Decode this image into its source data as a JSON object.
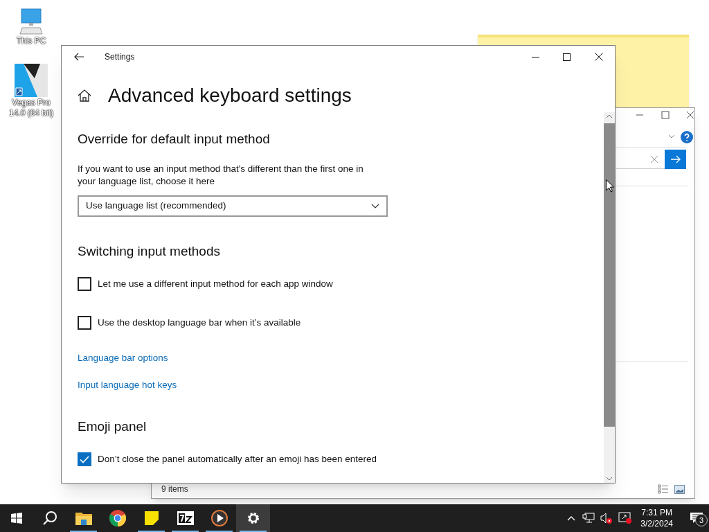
{
  "desktop_icons": [
    {
      "kind": "computer",
      "label": "This PC"
    },
    {
      "kind": "vegas",
      "label": "Vegas Pro 14.0 (64 bit)"
    }
  ],
  "background_window": {
    "status": "9 items"
  },
  "settings": {
    "title": "Settings",
    "heading": "Advanced keyboard settings",
    "sections": [
      {
        "title": "Override for default input method",
        "items": [
          {
            "kind": "text",
            "text": "If you want to use an input method that's different than the first one in your language list, choose it here"
          },
          {
            "kind": "dropdown",
            "value": "Use language list (recommended)"
          }
        ]
      },
      {
        "title": "Switching input methods",
        "items": [
          {
            "kind": "checkbox",
            "label": "Let me use a different input method for each app window",
            "checked": false
          },
          {
            "kind": "checkbox",
            "label": "Use the desktop language bar when it’s available",
            "checked": false
          },
          {
            "kind": "link",
            "label": "Language bar options"
          },
          {
            "kind": "link",
            "label": "Input language hot keys"
          }
        ]
      },
      {
        "title": "Emoji panel",
        "items": [
          {
            "kind": "checkbox",
            "label": "Don’t close the panel automatically after an emoji has been entered",
            "checked": true
          }
        ]
      }
    ]
  },
  "taskbar": {
    "apps": [
      {
        "kind": "explorer",
        "running": true,
        "selected": false
      },
      {
        "kind": "chrome",
        "running": false,
        "selected": false
      },
      {
        "kind": "notes",
        "running": true,
        "selected": false
      },
      {
        "kind": "zip",
        "running": true,
        "selected": false
      },
      {
        "kind": "player",
        "running": true,
        "selected": false
      },
      {
        "kind": "settings",
        "running": true,
        "selected": true
      }
    ],
    "time": "7:31 PM",
    "date": "3/2/2024",
    "notifications": "3"
  }
}
